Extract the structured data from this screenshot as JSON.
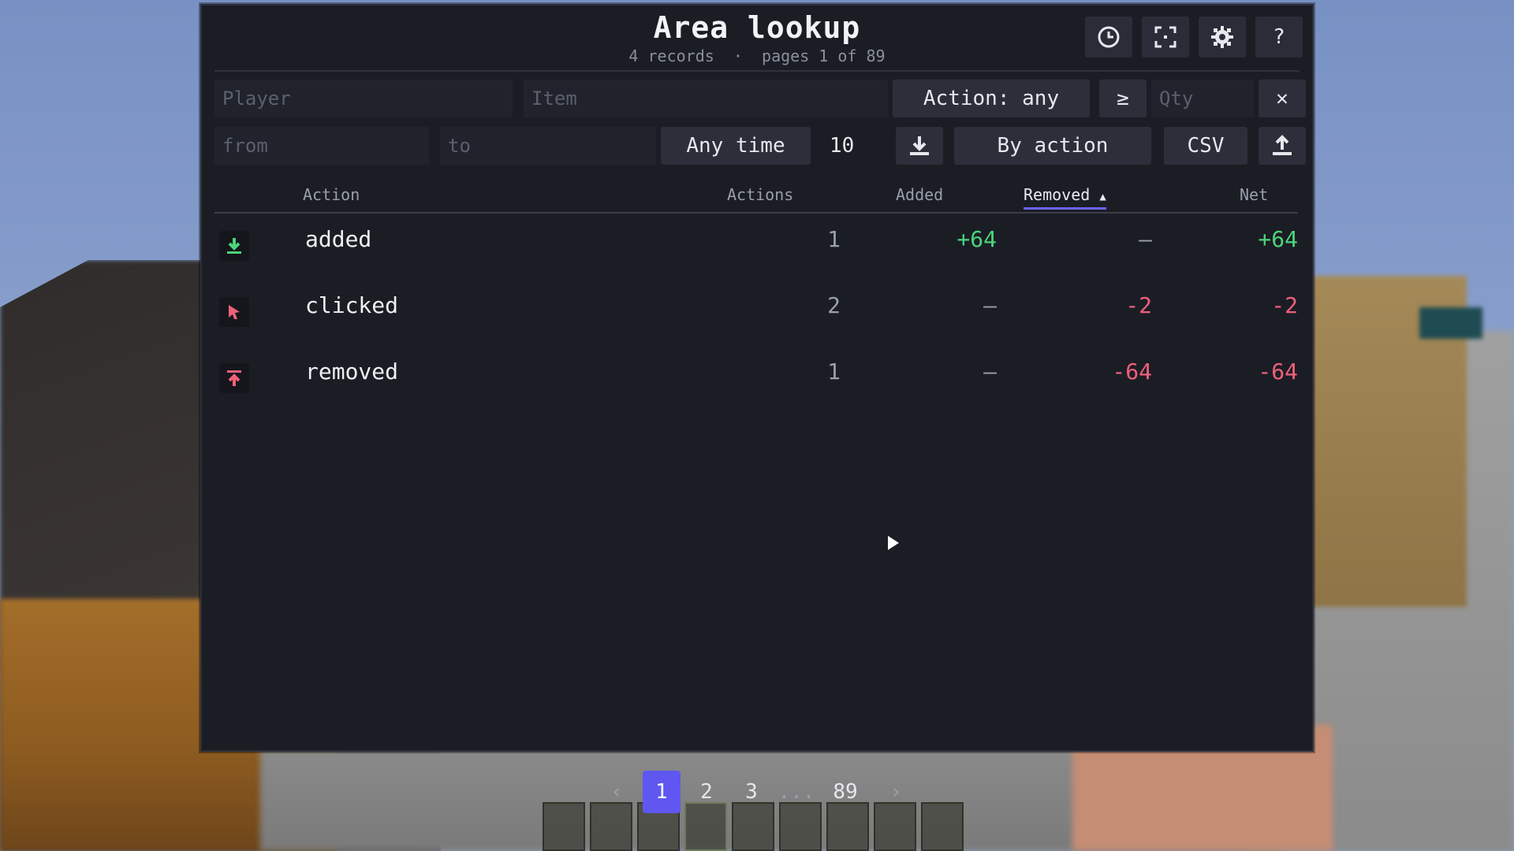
{
  "panel": {
    "title": "Area lookup",
    "subtitle_records": "4 records",
    "subtitle_sep": "·",
    "subtitle_pages": "pages 1 of 89",
    "top_icons": [
      "clock-icon",
      "fullscreen-icon",
      "gear-icon",
      "help-icon"
    ],
    "help_label": "?"
  },
  "filters": {
    "player_placeholder": "Player",
    "item_placeholder": "Item",
    "action_label": "Action: any",
    "compare_label": "≥",
    "qty_placeholder": "Qty",
    "clear_label": "✕",
    "from_placeholder": "from",
    "to_placeholder": "to",
    "time_label": "Any time",
    "limit_value": "10",
    "group_label": "By action",
    "csv_label": "CSV"
  },
  "table": {
    "columns": {
      "action": "Action",
      "actions": "Actions",
      "added": "Added",
      "removed": "Removed",
      "net": "Net"
    },
    "sort_indicator": "▲",
    "rows": [
      {
        "icon": "download-arrow-icon",
        "action": "added",
        "actions": "1",
        "added": "+64",
        "removed": "—",
        "net": "+64"
      },
      {
        "icon": "cursor-click-icon",
        "action": "clicked",
        "actions": "2",
        "added": "—",
        "removed": "-2",
        "net": "-2"
      },
      {
        "icon": "upload-arrow-icon",
        "action": "removed",
        "actions": "1",
        "added": "—",
        "removed": "-64",
        "net": "-64"
      }
    ]
  },
  "pagination": {
    "prev": "‹",
    "pages": [
      "1",
      "2",
      "3"
    ],
    "ellipsis": "...",
    "last": "89",
    "next": "›",
    "current": "1"
  },
  "colors": {
    "accent": "#5f57f0",
    "positive": "#4cd47a",
    "negative": "#f0607a",
    "neutral": "#9aa0ab"
  }
}
